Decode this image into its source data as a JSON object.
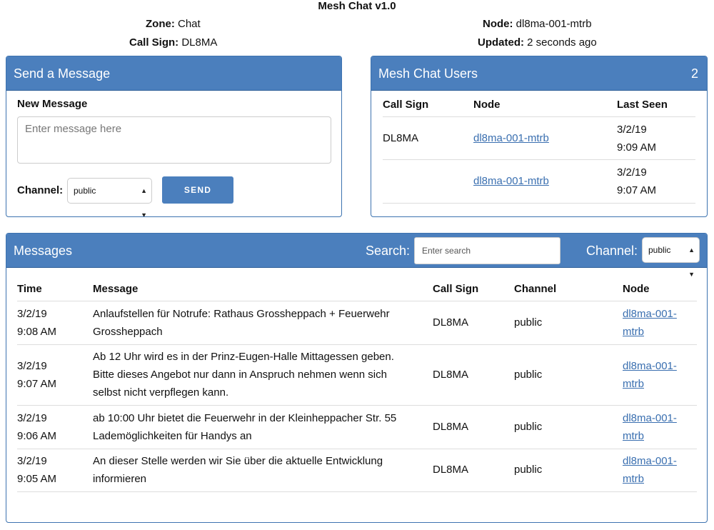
{
  "app": {
    "title": "Mesh Chat v1.0"
  },
  "status": {
    "zone_label": "Zone:",
    "zone_value": "Chat",
    "callsign_label": "Call Sign:",
    "callsign_value": "DL8MA",
    "node_label": "Node:",
    "node_value": "dl8ma-001-mtrb",
    "updated_label": "Updated:",
    "updated_value": "2 seconds ago"
  },
  "send_panel": {
    "title": "Send a Message",
    "new_message_label": "New Message",
    "message_placeholder": "Enter message here",
    "channel_label": "Channel:",
    "channel_selected": "public",
    "send_label": "SEND"
  },
  "users_panel": {
    "title": "Mesh Chat Users",
    "count": "2",
    "headers": {
      "callsign": "Call Sign",
      "node": "Node",
      "last_seen": "Last Seen"
    },
    "rows": [
      {
        "callsign": "DL8MA",
        "node": "dl8ma-001-mtrb",
        "date": "3/2/19",
        "time": "9:09 AM"
      },
      {
        "callsign": "",
        "node": "dl8ma-001-mtrb",
        "date": "3/2/19",
        "time": "9:07 AM"
      }
    ]
  },
  "messages_panel": {
    "title": "Messages",
    "search_label": "Search:",
    "search_placeholder": "Enter search",
    "channel_label": "Channel:",
    "channel_selected": "public",
    "headers": {
      "time": "Time",
      "message": "Message",
      "callsign": "Call Sign",
      "channel": "Channel",
      "node": "Node"
    },
    "rows": [
      {
        "date": "3/2/19",
        "time": "9:08 AM",
        "line1": "Anlaufstellen für Notrufe: Rathaus Grossheppach + Feuerwehr",
        "line2": "Grossheppach",
        "line3": "",
        "callsign": "DL8MA",
        "channel": "public",
        "node1": "dl8ma-001-",
        "node2": "mtrb"
      },
      {
        "date": "3/2/19",
        "time": "9:07 AM",
        "line1": "Ab 12 Uhr wird es in der Prinz-Eugen-Halle Mittagessen geben.",
        "line2": "Bitte dieses Angebot nur dann in Anspruch nehmen wenn sich",
        "line3": "selbst nicht verpflegen kann.",
        "callsign": "DL8MA",
        "channel": "public",
        "node1": "dl8ma-001-",
        "node2": "mtrb"
      },
      {
        "date": "3/2/19",
        "time": "9:06 AM",
        "line1": "ab 10:00 Uhr bietet die Feuerwehr in der Kleinheppacher Str. 55",
        "line2": "Lademöglichkeiten für Handys an",
        "line3": "",
        "callsign": "DL8MA",
        "channel": "public",
        "node1": "dl8ma-001-",
        "node2": "mtrb"
      },
      {
        "date": "3/2/19",
        "time": "9:05 AM",
        "line1": "An dieser Stelle werden wir Sie über die aktuelle Entwicklung",
        "line2": "informieren",
        "line3": "",
        "callsign": "DL8MA",
        "channel": "public",
        "node1": "dl8ma-001-",
        "node2": "mtrb"
      }
    ]
  },
  "colors": {
    "panel_header": "#4b7fbd",
    "link": "#3a6fb0",
    "border": "#3d73b0"
  }
}
